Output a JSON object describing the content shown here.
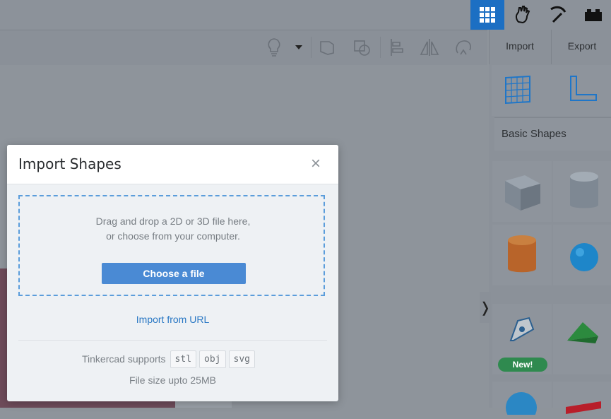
{
  "colors": {
    "accent": "#1c6fc3",
    "primary_button": "#4a8ad4",
    "link": "#2a78c4",
    "dropzone_border": "#5b9ddb",
    "new_badge": "#2f8a4f",
    "overlay": "#8c929a"
  },
  "top_modes": [
    {
      "icon": "grid-icon",
      "active": true
    },
    {
      "icon": "hand-icon",
      "active": false
    },
    {
      "icon": "pickaxe-icon",
      "active": false
    },
    {
      "icon": "brick-icon",
      "active": false
    }
  ],
  "toolbar": {
    "icons": [
      "lightbulb-icon",
      "dropdown-arrow-icon",
      "group-icon",
      "ungroup-icon",
      "align-icon",
      "mirror-icon",
      "cruise-icon"
    ]
  },
  "right_panel": {
    "import_label": "Import",
    "export_label": "Export",
    "category_label": "Basic Shapes",
    "new_badge": "New!",
    "collapse_glyph": "❭"
  },
  "dialog": {
    "title": "Import Shapes",
    "close_glyph": "×",
    "drop_line1": "Drag and drop a 2D or 3D file here,",
    "drop_line2": "or choose from your computer.",
    "choose_button": "Choose a file",
    "import_url_link": "Import from URL",
    "supports_label": "Tinkercad supports",
    "formats": [
      "stl",
      "obj",
      "svg"
    ],
    "file_size_note": "File size upto 25MB"
  }
}
